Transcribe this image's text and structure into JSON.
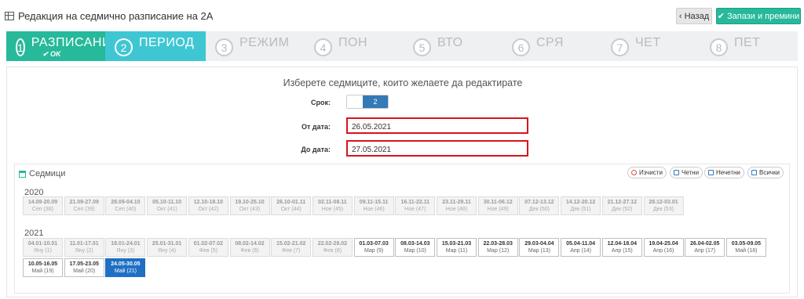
{
  "header": {
    "title": "Редакция на седмично разписание на 2А",
    "back_label": "Назад",
    "save_label": "Запази и премини"
  },
  "wizard": {
    "steps": [
      {
        "num": "1",
        "label": "РАЗПИСАНИЕ",
        "status": "OK"
      },
      {
        "num": "2",
        "label": "ПЕРИОД"
      },
      {
        "num": "3",
        "label": "РЕЖИМ"
      },
      {
        "num": "4",
        "label": "ПОН"
      },
      {
        "num": "5",
        "label": "ВТО"
      },
      {
        "num": "6",
        "label": "СРЯ"
      },
      {
        "num": "7",
        "label": "ЧЕТ"
      },
      {
        "num": "8",
        "label": "ПЕТ"
      }
    ]
  },
  "form": {
    "prompt": "Изберете седмиците, които желаете да редактирате",
    "term_label": "Срок:",
    "term_value": "2",
    "from_label": "От дата:",
    "from_value": "26.05.2021",
    "to_label": "До дата:",
    "to_value": "27.05.2021"
  },
  "weeks": {
    "title": "Седмици",
    "buttons": {
      "clear": "Изчисти",
      "even": "Четни",
      "odd": "Нечетни",
      "all": "Всички"
    },
    "years": [
      {
        "year": "2020",
        "items": [
          {
            "range": "14.09-20.09",
            "month": "Сеп (38)"
          },
          {
            "range": "21.09-27.09",
            "month": "Сеп (39)"
          },
          {
            "range": "28.09-04.10",
            "month": "Сеп (40)"
          },
          {
            "range": "05.10-11.10",
            "month": "Окт (41)"
          },
          {
            "range": "12.10-18.10",
            "month": "Окт (42)"
          },
          {
            "range": "19.10-25.10",
            "month": "Окт (43)"
          },
          {
            "range": "26.10-01.11",
            "month": "Окт (44)"
          },
          {
            "range": "02.11-08.11",
            "month": "Ное (45)"
          },
          {
            "range": "09.11-15.11",
            "month": "Ное (46)"
          },
          {
            "range": "16.11-22.11",
            "month": "Ное (47)"
          },
          {
            "range": "23.11-29.11",
            "month": "Ное (48)"
          },
          {
            "range": "30.11-06.12",
            "month": "Ное (49)"
          },
          {
            "range": "07.12-13.12",
            "month": "Дек (50)"
          },
          {
            "range": "14.12-20.12",
            "month": "Дек (51)"
          },
          {
            "range": "21.12-27.12",
            "month": "Дек (52)"
          },
          {
            "range": "28.12-03.01",
            "month": "Дек (53)"
          }
        ]
      },
      {
        "year": "2021",
        "items": [
          {
            "range": "04.01-10.01",
            "month": "Яну (1)"
          },
          {
            "range": "11.01-17.01",
            "month": "Яну (2)"
          },
          {
            "range": "18.01-24.01",
            "month": "Яну (3)"
          },
          {
            "range": "25.01-31.01",
            "month": "Яну (4)"
          },
          {
            "range": "01.02-07.02",
            "month": "Фев (5)"
          },
          {
            "range": "08.02-14.02",
            "month": "Фев (6)"
          },
          {
            "range": "15.02-21.02",
            "month": "Фев (7)"
          },
          {
            "range": "22.02-28.02",
            "month": "Фев (8)"
          },
          {
            "range": "01.03-07.03",
            "month": "Мар (9)",
            "active": true
          },
          {
            "range": "08.03-14.03",
            "month": "Мар (10)",
            "active": true
          },
          {
            "range": "15.03-21.03",
            "month": "Мар (11)",
            "active": true
          },
          {
            "range": "22.03-28.03",
            "month": "Мар (12)",
            "active": true
          },
          {
            "range": "29.03-04.04",
            "month": "Мар (13)",
            "active": true
          },
          {
            "range": "05.04-11.04",
            "month": "Апр (14)",
            "active": true
          },
          {
            "range": "12.04-18.04",
            "month": "Апр (15)",
            "active": true
          },
          {
            "range": "19.04-25.04",
            "month": "Апр (16)",
            "active": true
          },
          {
            "range": "26.04-02.05",
            "month": "Апр (17)",
            "active": true
          },
          {
            "range": "03.05-09.05",
            "month": "Май (18)",
            "active": true
          },
          {
            "range": "10.05-16.05",
            "month": "Май (19)",
            "active": true
          },
          {
            "range": "17.05-23.05",
            "month": "Май (20)",
            "active": true
          },
          {
            "range": "24.05-30.05",
            "month": "Май (21)",
            "selected": true
          }
        ]
      }
    ]
  }
}
